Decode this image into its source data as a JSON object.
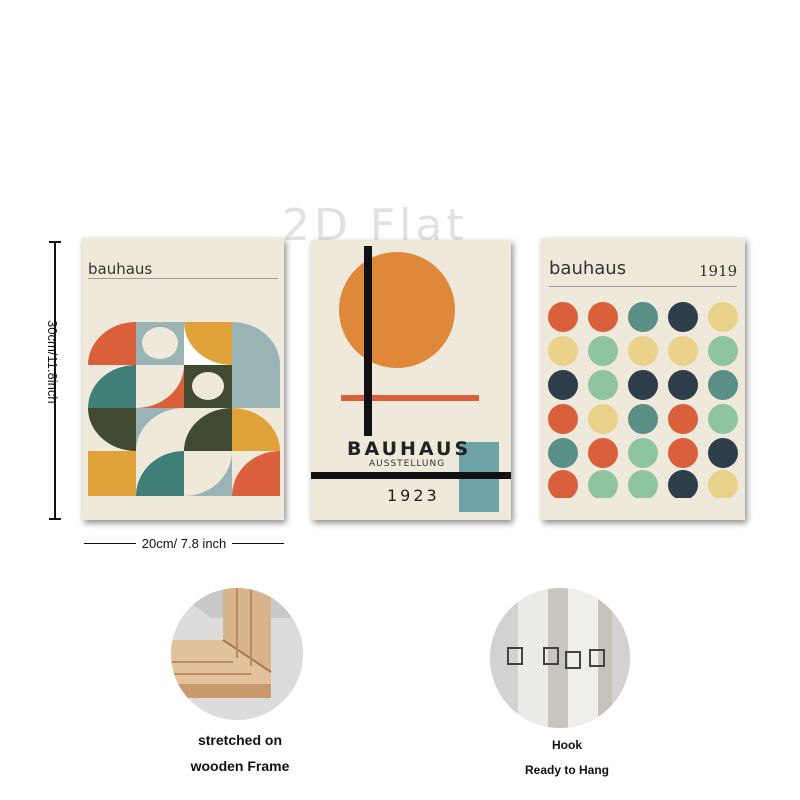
{
  "watermark": "2D Flat",
  "dimensions": {
    "height_label": "30cm/11.8inch",
    "width_label": "20cm/ 7.8 inch"
  },
  "posters": [
    {
      "title": "bauhaus"
    },
    {
      "title": "BAUHAUS",
      "subtitle": "AUSSTELLUNG",
      "year": "1923"
    },
    {
      "title": "bauhaus",
      "year": "1919"
    }
  ],
  "features": [
    {
      "line1": "stretched on",
      "line2": "wooden Frame"
    },
    {
      "line1": "Hook",
      "line2": "Ready to Hang"
    }
  ],
  "colors": {
    "cream": "#efe9dc",
    "red": "#d9603b",
    "orange": "#e0a33a",
    "teal": "#3f7f78",
    "slate": "#9ab3b5",
    "olive": "#3f4a30",
    "navy": "#2e3d4a",
    "green": "#8fc4a1",
    "yellow": "#ead18a"
  }
}
